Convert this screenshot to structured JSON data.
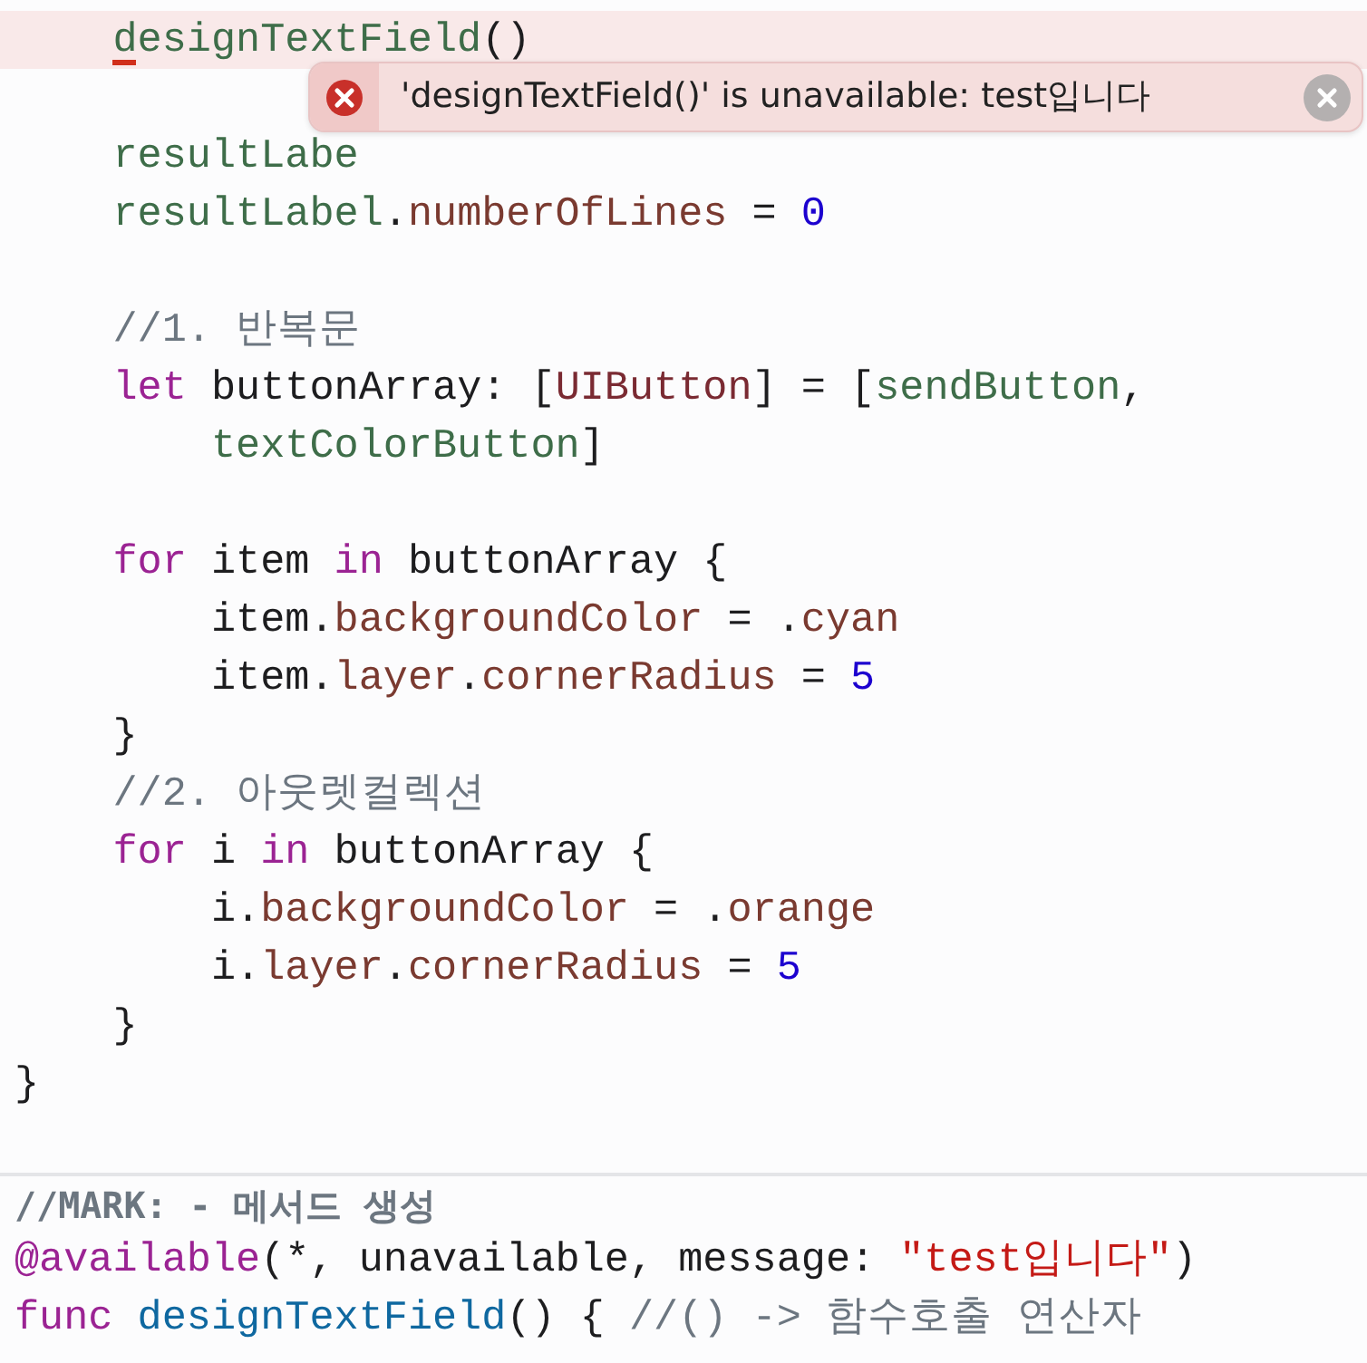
{
  "code_lines": [
    {
      "error": true,
      "tokens": [
        {
          "text": "    designTextField",
          "kind": "ident"
        },
        {
          "text": "()",
          "kind": "plain"
        }
      ]
    },
    {
      "gap_before": true,
      "tokens": [
        {
          "text": "    resultLabe",
          "kind": "ident"
        }
      ]
    },
    {
      "tokens": [
        {
          "text": "    resultLabel",
          "kind": "ident"
        },
        {
          "text": ".",
          "kind": "plain"
        },
        {
          "text": "numberOfLines",
          "kind": "property"
        },
        {
          "text": " = ",
          "kind": "plain"
        },
        {
          "text": "0",
          "kind": "number"
        }
      ]
    },
    {
      "gap_before": true,
      "tokens": [
        {
          "text": "    //1. 반복문",
          "kind": "comment"
        }
      ]
    },
    {
      "tokens": [
        {
          "text": "    let",
          "kind": "keyword"
        },
        {
          "text": " buttonArray: [",
          "kind": "plain"
        },
        {
          "text": "UIButton",
          "kind": "type"
        },
        {
          "text": "] = [",
          "kind": "plain"
        },
        {
          "text": "sendButton",
          "kind": "ident"
        },
        {
          "text": ",",
          "kind": "plain"
        }
      ]
    },
    {
      "tokens": [
        {
          "text": "        textColorButton",
          "kind": "ident"
        },
        {
          "text": "]",
          "kind": "plain"
        }
      ]
    },
    {
      "gap_before": true,
      "tokens": [
        {
          "text": "    for",
          "kind": "keyword"
        },
        {
          "text": " item ",
          "kind": "plain"
        },
        {
          "text": "in",
          "kind": "keyword"
        },
        {
          "text": " buttonArray {",
          "kind": "plain"
        }
      ]
    },
    {
      "tokens": [
        {
          "text": "        item.",
          "kind": "plain"
        },
        {
          "text": "backgroundColor",
          "kind": "property"
        },
        {
          "text": " = .",
          "kind": "plain"
        },
        {
          "text": "cyan",
          "kind": "property"
        }
      ]
    },
    {
      "tokens": [
        {
          "text": "        item.",
          "kind": "plain"
        },
        {
          "text": "layer",
          "kind": "property"
        },
        {
          "text": ".",
          "kind": "plain"
        },
        {
          "text": "cornerRadius",
          "kind": "property"
        },
        {
          "text": " = ",
          "kind": "plain"
        },
        {
          "text": "5",
          "kind": "number"
        }
      ]
    },
    {
      "tokens": [
        {
          "text": "    }",
          "kind": "plain"
        }
      ]
    },
    {
      "tokens": [
        {
          "text": "    //2. 아웃렛컬렉션",
          "kind": "comment"
        }
      ]
    },
    {
      "tokens": [
        {
          "text": "    for",
          "kind": "keyword"
        },
        {
          "text": " i ",
          "kind": "plain"
        },
        {
          "text": "in",
          "kind": "keyword"
        },
        {
          "text": " buttonArray {",
          "kind": "plain"
        }
      ]
    },
    {
      "tokens": [
        {
          "text": "        i.",
          "kind": "plain"
        },
        {
          "text": "backgroundColor",
          "kind": "property"
        },
        {
          "text": " = .",
          "kind": "plain"
        },
        {
          "text": "orange",
          "kind": "property"
        }
      ]
    },
    {
      "tokens": [
        {
          "text": "        i.",
          "kind": "plain"
        },
        {
          "text": "layer",
          "kind": "property"
        },
        {
          "text": ".",
          "kind": "plain"
        },
        {
          "text": "cornerRadius",
          "kind": "property"
        },
        {
          "text": " = ",
          "kind": "plain"
        },
        {
          "text": "5",
          "kind": "number"
        }
      ]
    },
    {
      "tokens": [
        {
          "text": "    }",
          "kind": "plain"
        }
      ]
    },
    {
      "tokens": [
        {
          "text": "}",
          "kind": "plain"
        }
      ]
    }
  ],
  "section_lines": [
    {
      "tokens": [
        {
          "text": "//MARK: - 메서드 생성",
          "kind": "mark"
        }
      ]
    },
    {
      "tokens": [
        {
          "text": "@available",
          "kind": "keyword"
        },
        {
          "text": "(*, unavailable, message: ",
          "kind": "plain"
        },
        {
          "text": "\"test입니다\"",
          "kind": "string"
        },
        {
          "text": ")",
          "kind": "plain"
        }
      ]
    },
    {
      "tokens": [
        {
          "text": "func ",
          "kind": "keyword"
        },
        {
          "text": "designTextField",
          "kind": "funcname"
        },
        {
          "text": "() { ",
          "kind": "plain"
        },
        {
          "text": "//() -> 함수호출 연산자",
          "kind": "comment"
        }
      ]
    }
  ],
  "error_popup": {
    "message": "'designTextField()' is unavailable: test입니다"
  }
}
